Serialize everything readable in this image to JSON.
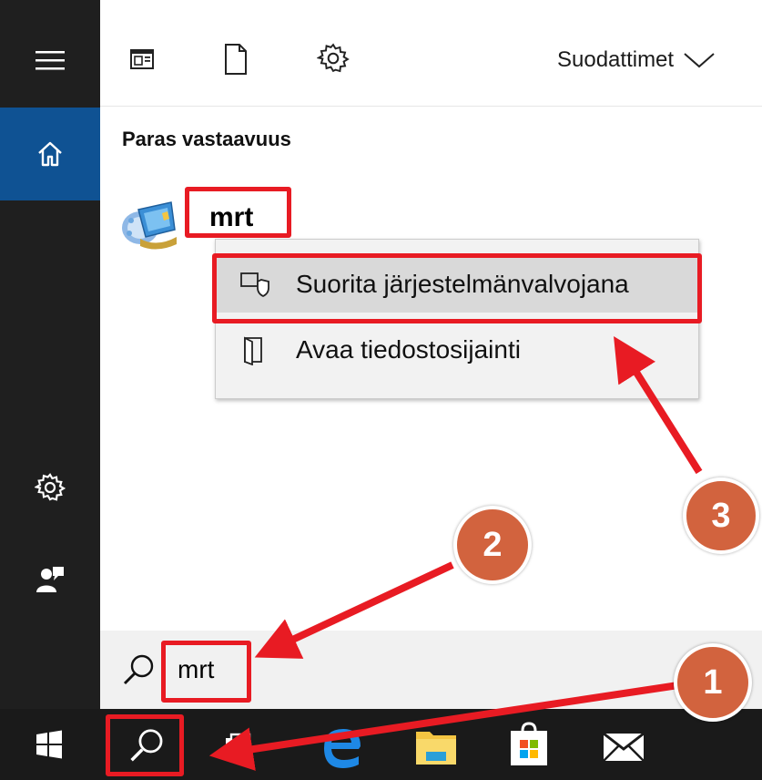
{
  "header": {
    "filter_label": "Suodattimet",
    "icons": [
      "apps-icon",
      "document-icon",
      "settings-icon",
      "chevron-down-icon"
    ]
  },
  "sidebar": {
    "items": [
      {
        "icon": "hamburger-menu-icon"
      },
      {
        "icon": "home-icon",
        "selected": true
      },
      {
        "icon": "settings-icon"
      },
      {
        "icon": "user-feedback-icon"
      }
    ]
  },
  "results": {
    "section_title": "Paras vastaavuus",
    "best_match": {
      "name": "mrt",
      "icon": "malicious-software-removal-tool-icon"
    }
  },
  "context_menu": {
    "items": [
      {
        "label": "Suorita järjestelmänvalvojana",
        "icon": "run-as-admin-shield-icon",
        "highlighted": true
      },
      {
        "label": "Avaa tiedostosijainti",
        "icon": "open-file-location-icon"
      }
    ]
  },
  "search": {
    "value": "mrt",
    "icon": "search-icon"
  },
  "taskbar": {
    "items": [
      "windows-start-icon",
      "search-icon",
      "task-view-icon",
      "edge-icon",
      "file-explorer-icon",
      "store-icon",
      "mail-icon"
    ]
  },
  "annotations": {
    "steps": [
      "1",
      "2",
      "3"
    ],
    "colors": {
      "box": "#e81b23",
      "arrow": "#e81b23",
      "badge": "#d2633e"
    }
  },
  "colors": {
    "rail": "#1f1f1f",
    "accent": "#0f5293",
    "taskbar": "#1a1a1a",
    "search_bg": "#f1f1f1",
    "menu_bg": "#f2f2f2",
    "menu_highlight": "#d9d9d9"
  }
}
